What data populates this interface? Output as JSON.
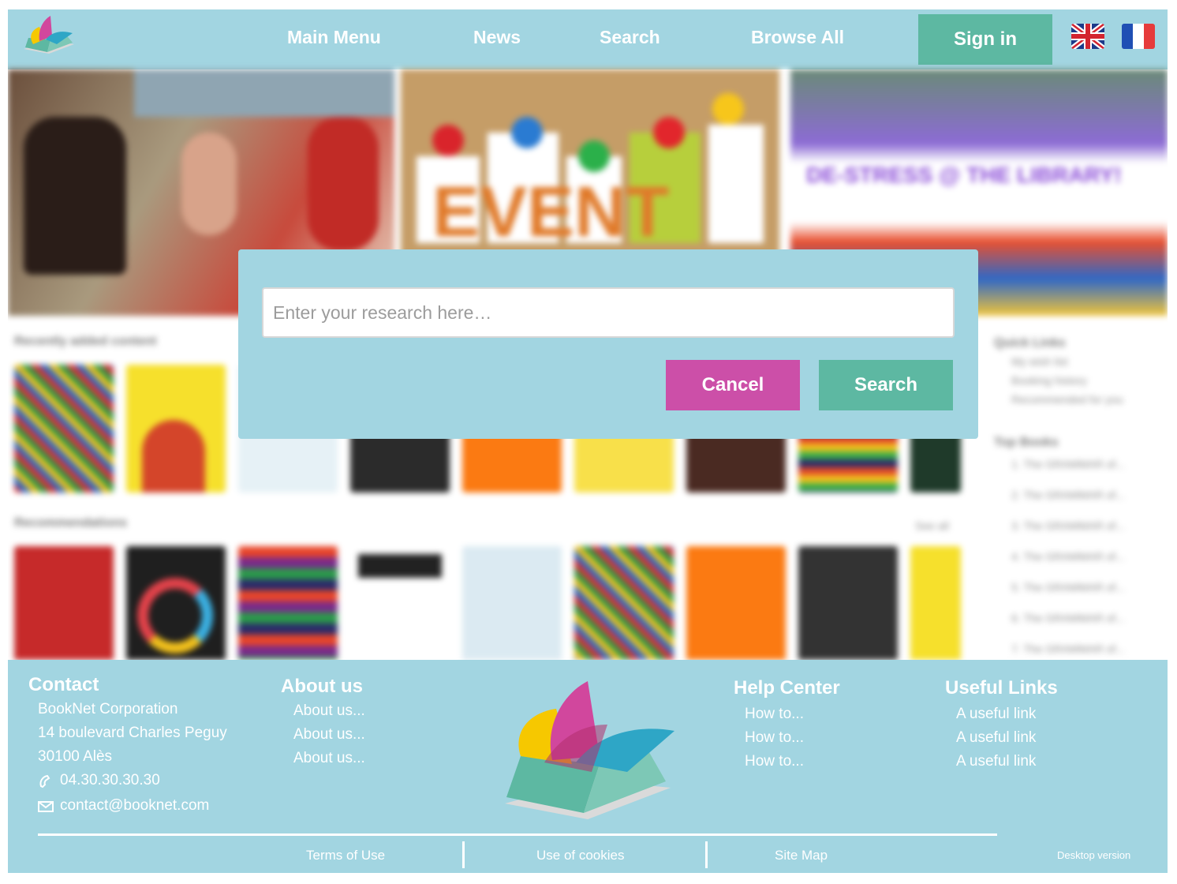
{
  "nav": {
    "items": [
      "Main Menu",
      "News",
      "Search",
      "Browse All"
    ],
    "signin_label": "Sign in",
    "flags": [
      "uk-flag",
      "france-flag"
    ]
  },
  "background": {
    "banner_text": [
      "EVENT",
      "DE-STRESS @ THE LIBRARY!"
    ],
    "section_titles": [
      "Recently added content",
      "Recommendations"
    ],
    "sidebar_titles": [
      "Quick Links",
      "Top Books"
    ],
    "quick_links": [
      "My wish list",
      "Booking history",
      "Recommended for you"
    ],
    "top_books": [
      "1. The GRAMMAR of...",
      "2. The GRAMMAR of...",
      "3. The GRAMMAR of...",
      "4. The GRAMMAR of...",
      "5. The GRAMMAR of...",
      "6. The GRAMMAR of...",
      "7. The GRAMMAR of..."
    ],
    "see_all": "See all"
  },
  "modal": {
    "placeholder": "Enter your research here…",
    "cancel_label": "Cancel",
    "search_label": "Search"
  },
  "footer": {
    "contact": {
      "title": "Contact",
      "company": "BookNet Corporation",
      "street": "14 boulevard Charles Peguy",
      "city": "30100 Alès",
      "phone": "04.30.30.30.30",
      "email": "contact@booknet.com"
    },
    "about": {
      "title": "About us",
      "links": [
        "About us...",
        "About us...",
        "About us..."
      ]
    },
    "help": {
      "title": "Help Center",
      "links": [
        "How to...",
        "How to...",
        "How to..."
      ]
    },
    "useful": {
      "title": "Useful Links",
      "links": [
        "A useful link",
        "A useful link",
        "A useful link"
      ]
    },
    "bottom_links": [
      "Terms of Use",
      "Use of cookies",
      "Site Map"
    ],
    "desktop_version": "Desktop version"
  },
  "colors": {
    "header_bg": "#a2d5e1",
    "accent_green": "#5db8a2",
    "accent_pink": "#cc4fa8",
    "text_white": "#ffffff"
  }
}
